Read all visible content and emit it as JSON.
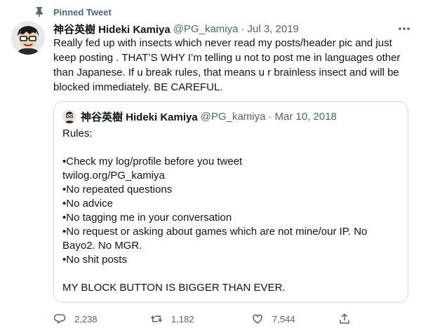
{
  "pinned": {
    "label": "Pinned Tweet",
    "icon": "pin-icon"
  },
  "tweet": {
    "display_name": "神谷英樹 Hideki Kamiya",
    "handle": "@PG_kamiya",
    "separator": "·",
    "date": "Jul 3, 2019",
    "more_icon": "more-horizontal-icon",
    "text": "Really fed up with insects which never read my posts/header pic and just keep posting . THAT’S WHY I’m telling u not to post me in languages other than Japanese. If u break rules, that means u r brainless insect and will be blocked immediately. BE CAREFUL."
  },
  "quote": {
    "display_name": "神谷英樹 Hideki Kamiya",
    "handle": "@PG_kamiya",
    "separator": "·",
    "date": "Mar 10, 2018",
    "lines": [
      "Rules:",
      "",
      "•Check my log/profile before you tweet",
      "twilog.org/PG_kamiya",
      "•No repeated questions",
      "•No advice",
      "•No tagging me in your conversation",
      "•No request or asking about games which are not mine/our IP. No",
      "Bayo2. No MGR.",
      "•No shit posts",
      "",
      "MY BLOCK BUTTON IS BIGGER THAN EVER."
    ]
  },
  "actions": {
    "reply": {
      "icon": "reply-icon",
      "count": "2,238"
    },
    "retweet": {
      "icon": "retweet-icon",
      "count": "1,182"
    },
    "like": {
      "icon": "like-icon",
      "count": "7,544"
    },
    "share": {
      "icon": "share-icon"
    }
  },
  "colors": {
    "text": "#0f1419",
    "secondary": "#536471",
    "border": "#cfd9de"
  }
}
